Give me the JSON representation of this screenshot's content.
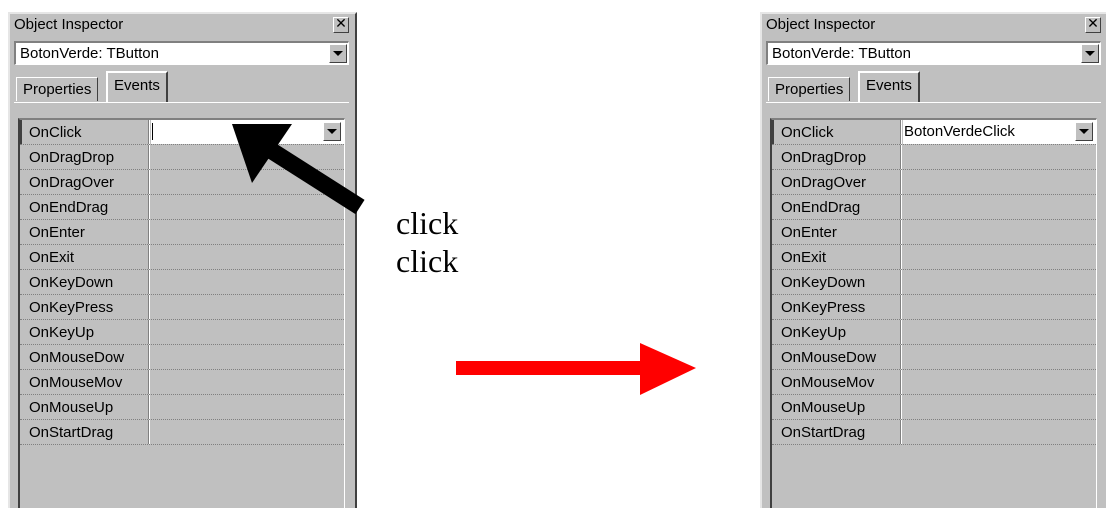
{
  "panels": [
    {
      "title": "Object Inspector",
      "close_glyph": "✕",
      "component": "BotonVerde: TButton",
      "tabs": [
        "Properties",
        "Events"
      ],
      "active_tab": "Events",
      "events": [
        "OnClick",
        "OnDragDrop",
        "OnDragOver",
        "OnEndDrag",
        "OnEnter",
        "OnExit",
        "OnKeyDown",
        "OnKeyPress",
        "OnKeyUp",
        "OnMouseDow",
        "OnMouseMov",
        "OnMouseUp",
        "OnStartDrag"
      ],
      "onclick_value": ""
    },
    {
      "title": "Object Inspector",
      "close_glyph": "✕",
      "component": "BotonVerde: TButton",
      "tabs": [
        "Properties",
        "Events"
      ],
      "active_tab": "Events",
      "events": [
        "OnClick",
        "OnDragDrop",
        "OnDragOver",
        "OnEndDrag",
        "OnEnter",
        "OnExit",
        "OnKeyDown",
        "OnKeyPress",
        "OnKeyUp",
        "OnMouseDow",
        "OnMouseMov",
        "OnMouseUp",
        "OnStartDrag"
      ],
      "onclick_value": "BotonVerdeClick"
    }
  ],
  "annotation": {
    "line1": "click",
    "line2": "click"
  },
  "colors": {
    "window_face": "#c0c0c0",
    "edit_bg": "#ffffff",
    "pointer_arrow": "#000000",
    "transition_arrow": "#ff0000"
  },
  "icons": {
    "pointer": "black-pointer-arrow-icon",
    "transition": "red-right-arrow-icon"
  }
}
